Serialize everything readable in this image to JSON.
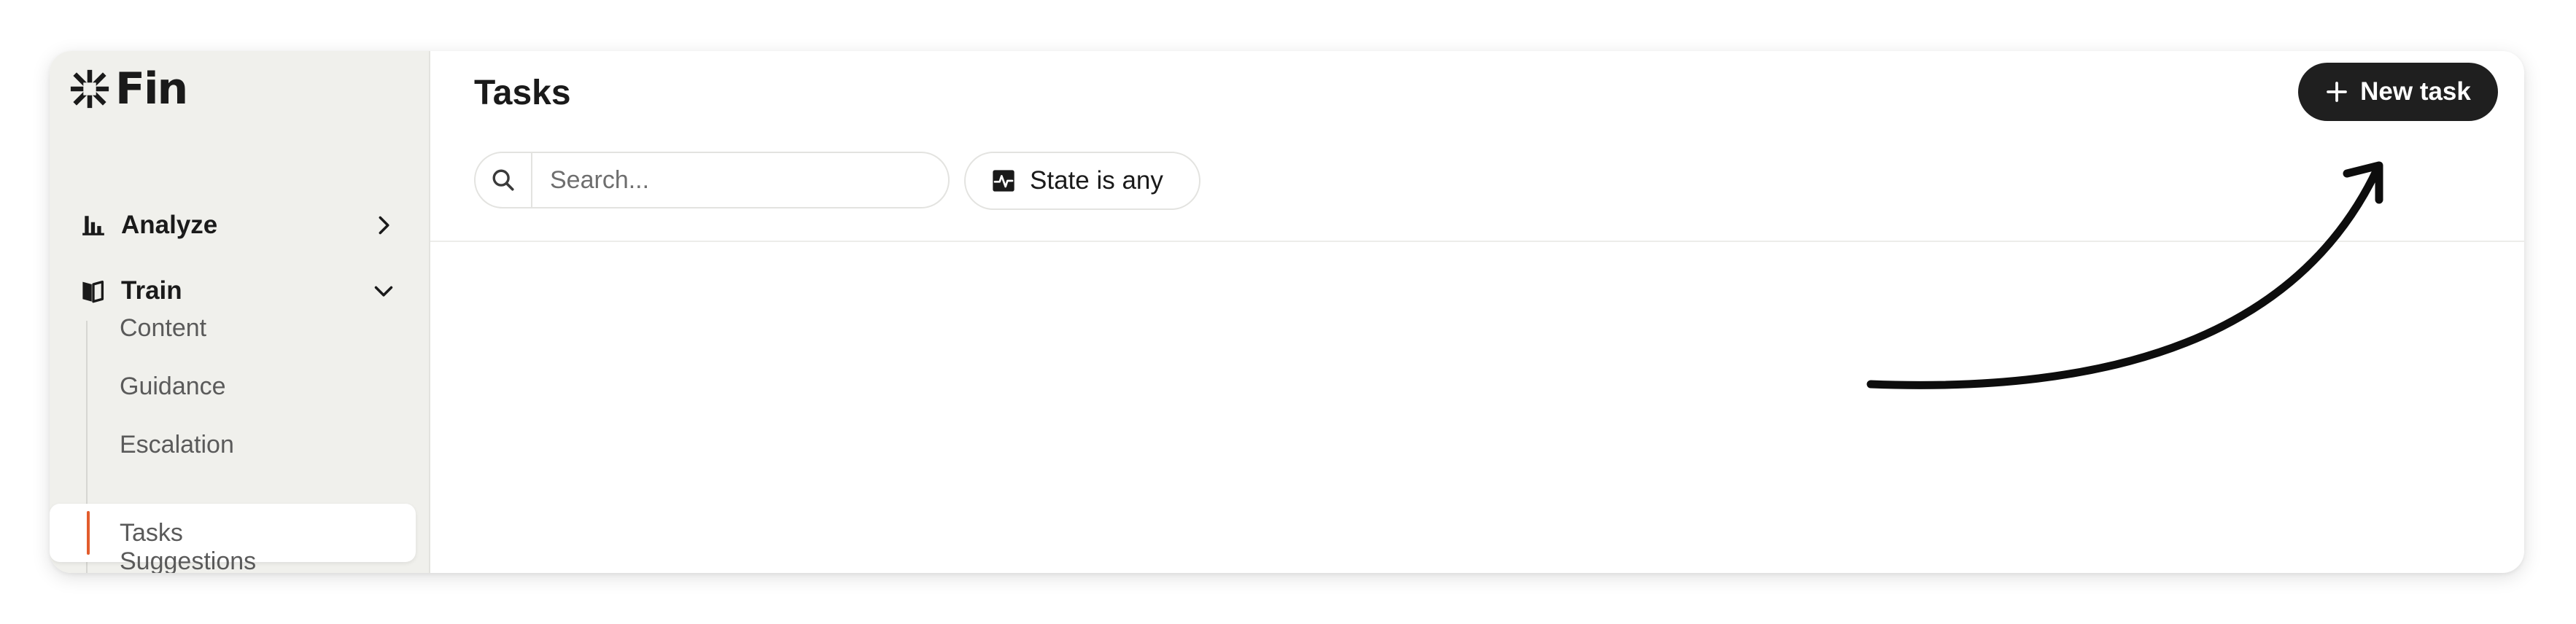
{
  "brand": {
    "name": "Fin"
  },
  "sidebar": {
    "items": [
      {
        "label": "Analyze",
        "icon": "bar-chart-icon",
        "expanded": false
      },
      {
        "label": "Train",
        "icon": "book-icon",
        "expanded": true
      }
    ],
    "sub_items": [
      "Content",
      "Guidance",
      "Escalation",
      "Tasks",
      "Suggestions"
    ],
    "active_sub_item": "Tasks"
  },
  "main": {
    "title": "Tasks",
    "new_task_label": "New task",
    "search": {
      "placeholder": "Search...",
      "value": ""
    },
    "state_filter_label": "State is any"
  },
  "colors": {
    "sidebar_bg": "#f0f0ec",
    "accent": "#e25c2c",
    "primary_button": "#1f1f1f"
  }
}
